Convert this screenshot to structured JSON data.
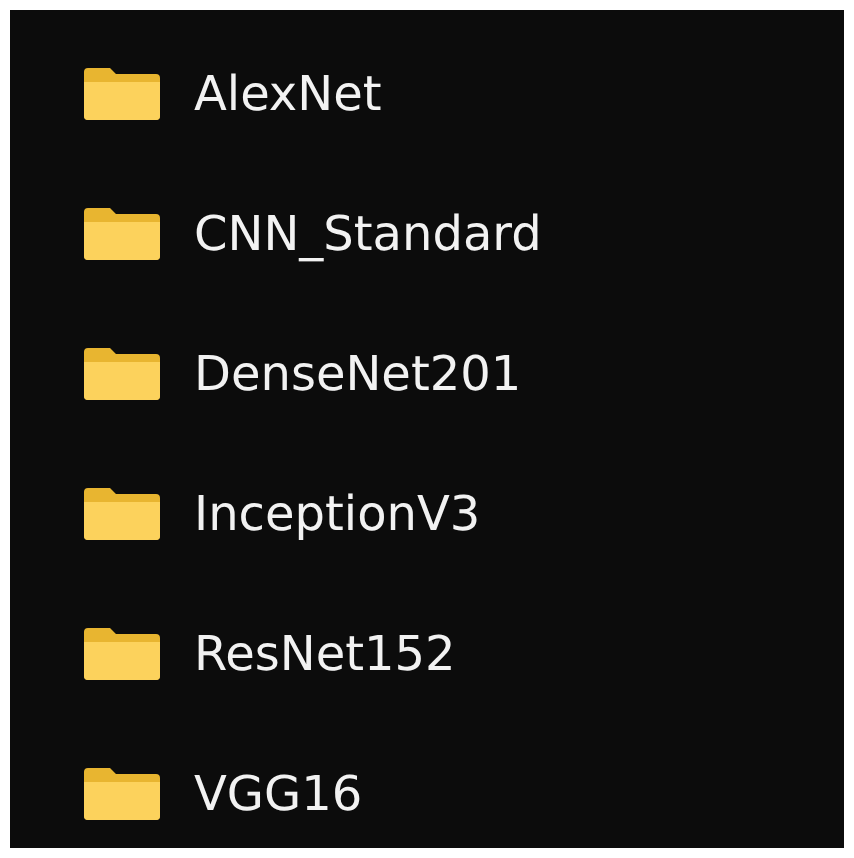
{
  "folders": [
    {
      "name": "AlexNet"
    },
    {
      "name": "CNN_Standard"
    },
    {
      "name": "DenseNet201"
    },
    {
      "name": "InceptionV3"
    },
    {
      "name": "ResNet152"
    },
    {
      "name": "VGG16"
    }
  ]
}
